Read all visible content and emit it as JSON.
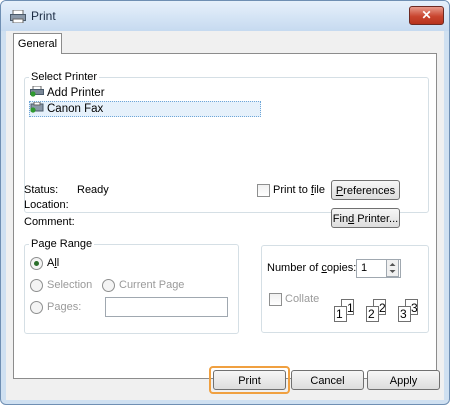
{
  "window": {
    "title": "Print",
    "close_glyph": "✕"
  },
  "tabs": [
    {
      "label": "General",
      "selected": true
    }
  ],
  "select_printer": {
    "legend": "Select Printer",
    "printers": [
      {
        "name": "Add Printer",
        "icon": "add-printer-icon",
        "selected": false
      },
      {
        "name": "Canon Fax",
        "icon": "fax-printer-icon",
        "selected": true
      }
    ],
    "status_label": "Status:",
    "status_value": "Ready",
    "location_label": "Location:",
    "comment_label": "Comment:",
    "print_to_file": {
      "label_pre": "Print to ",
      "label_key": "f",
      "label_post": "ile",
      "checked": false
    },
    "preferences_button": {
      "pre": "",
      "key": "P",
      "post": "references"
    },
    "find_printer_button": {
      "pre": "Fin",
      "key": "d",
      "post": " Printer..."
    }
  },
  "page_range": {
    "legend": "Page Range",
    "options": {
      "all": {
        "pre": "",
        "key": "l",
        "full": "All",
        "checked": true
      },
      "selection": {
        "label": "Selection",
        "checked": false,
        "enabled": false
      },
      "current_page": {
        "label": "Current Page",
        "checked": false,
        "enabled": false
      },
      "pages": {
        "label": "Pages:",
        "checked": false,
        "enabled": false
      }
    },
    "pages_value": ""
  },
  "copies": {
    "label_pre": "Number of ",
    "label_key": "c",
    "label_post": "opies:",
    "value": "1",
    "collate_label": "Collate",
    "collate_checked": false,
    "collate_pages": [
      "1",
      "1",
      "2",
      "2",
      "3",
      "3"
    ]
  },
  "buttons": {
    "print": "Print",
    "cancel": "Cancel",
    "apply": "Apply"
  },
  "colors": {
    "selection_highlight": "#e6f1fb",
    "focus_ring": "#f0a040",
    "close_button": "#c9452f"
  }
}
